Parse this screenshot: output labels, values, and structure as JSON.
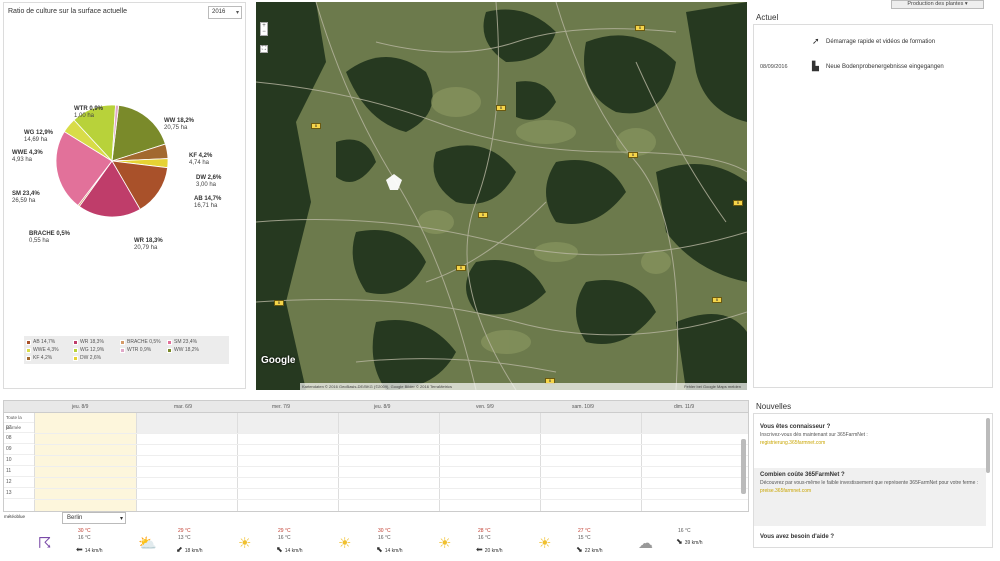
{
  "left_panel": {
    "title": "Ratio de culture sur la surface actuelle",
    "year": "2016"
  },
  "chart_data": {
    "type": "pie",
    "title": "Ratio de culture sur la surface actuelle",
    "slices": [
      {
        "name": "WW",
        "percent": 18.2,
        "area": "20,75 ha",
        "label_pct": "WW 18,2%",
        "color": "#7a8a2a"
      },
      {
        "name": "KF",
        "percent": 4.2,
        "area": "4,74 ha",
        "label_pct": "KF 4,2%",
        "color": "#a2692f"
      },
      {
        "name": "DW",
        "percent": 2.6,
        "area": "3,00 ha",
        "label_pct": "DW 2,6%",
        "color": "#e6d233"
      },
      {
        "name": "AB",
        "percent": 14.7,
        "area": "16,71 ha",
        "label_pct": "AB 14,7%",
        "color": "#a9512a"
      },
      {
        "name": "WR",
        "percent": 18.3,
        "area": "20,79 ha",
        "label_pct": "WR 18,3%",
        "color": "#bf3d6a"
      },
      {
        "name": "BRACHE",
        "percent": 0.5,
        "area": "0,55 ha",
        "label_pct": "BRACHE 0,5%",
        "color": "#d49a68"
      },
      {
        "name": "SM",
        "percent": 23.4,
        "area": "26,59 ha",
        "label_pct": "SM 23,4%",
        "color": "#e2719a"
      },
      {
        "name": "WWE",
        "percent": 4.3,
        "area": "4,93 ha",
        "label_pct": "WWE 4,3%",
        "color": "#d8dc48"
      },
      {
        "name": "WG",
        "percent": 12.9,
        "area": "14,69 ha",
        "label_pct": "WG 12,9%",
        "color": "#b8d23a"
      },
      {
        "name": "WTR",
        "percent": 0.9,
        "area": "1,00 ha",
        "label_pct": "WTR 0,9%",
        "color": "#e0a8c8"
      }
    ],
    "legend": [
      "AB 14,7%",
      "WR 18,3%",
      "BRACHE 0,5%",
      "SM 23,4%",
      "WWE 4,3%",
      "WG 12,9%",
      "WTR 0,9%",
      "WW 18,2%",
      "KF 4,2%",
      "DW 2,6%"
    ],
    "legend_colors": [
      "#a9512a",
      "#bf3d6a",
      "#d49a68",
      "#e2719a",
      "#d8dc48",
      "#b8d23a",
      "#e0a8c8",
      "#7a8a2a",
      "#a2692f",
      "#e6d233"
    ]
  },
  "map": {
    "google_logo": "Google",
    "attribution": "Kartendaten © 2016 GeoBasis-DE/BKG (©2009), Google Bilder © 2016 TerraMetrics",
    "terms": "Fehler bei Google Maps melden",
    "zoom_in": "+",
    "zoom_out": "−"
  },
  "top_right": {
    "button_label": "Production des plantes ▾"
  },
  "actuel": {
    "title": "Actuel",
    "items": [
      {
        "date": "",
        "icon": "rocket-icon",
        "text": "Démarrage rapide et vidéos de formation"
      },
      {
        "date": "08/09/2016",
        "icon": "tractor-icon",
        "text": "Neue Bodenprobenergebnisse eingegangen"
      }
    ]
  },
  "calendar": {
    "days": [
      "jeu. 8/9",
      "mar. 6/9",
      "mer. 7/9",
      "jeu. 8/9",
      "ven. 9/9",
      "sam. 10/9",
      "dim. 11/9"
    ],
    "rows": [
      "Toute la journée",
      "07",
      "08",
      "09",
      "10",
      "11",
      "12",
      "13"
    ]
  },
  "weather": {
    "label": "météoblue",
    "city": "Berlin",
    "days": [
      {
        "icon": "storm-icon",
        "max": "30 °C",
        "min": "16 °C",
        "wind": "14 km/h"
      },
      {
        "icon": "cloud-sun-icon",
        "max": "29 °C",
        "min": "13 °C",
        "wind": "18 km/h"
      },
      {
        "icon": "sun-icon",
        "max": "29 °C",
        "min": "16 °C",
        "wind": "14 km/h"
      },
      {
        "icon": "sun-icon",
        "max": "30 °C",
        "min": "16 °C",
        "wind": "14 km/h"
      },
      {
        "icon": "sun-icon",
        "max": "28 °C",
        "min": "16 °C",
        "wind": "20 km/h"
      },
      {
        "icon": "sun-icon",
        "max": "27 °C",
        "min": "15 °C",
        "wind": "22 km/h"
      },
      {
        "icon": "cloud-icon",
        "max": "",
        "min": "16 °C",
        "wind": "39 km/h"
      }
    ]
  },
  "news": {
    "title": "Nouvelles",
    "items": [
      {
        "title": "Vous êtes connaisseur ?",
        "text": "Inscrivez-vous dès maintenant sur 365FarmNet :",
        "link": "registrierung.365farmnet.com"
      },
      {
        "title": "Combien coûte 365FarmNet ?",
        "text": "Découvrez par vous-même le faible investissement que représente 365FarmNet pour votre ferme :",
        "link": "preise.365farmnet.com"
      },
      {
        "title": "Vous avez besoin d'aide ?",
        "text": "",
        "link": ""
      }
    ]
  }
}
